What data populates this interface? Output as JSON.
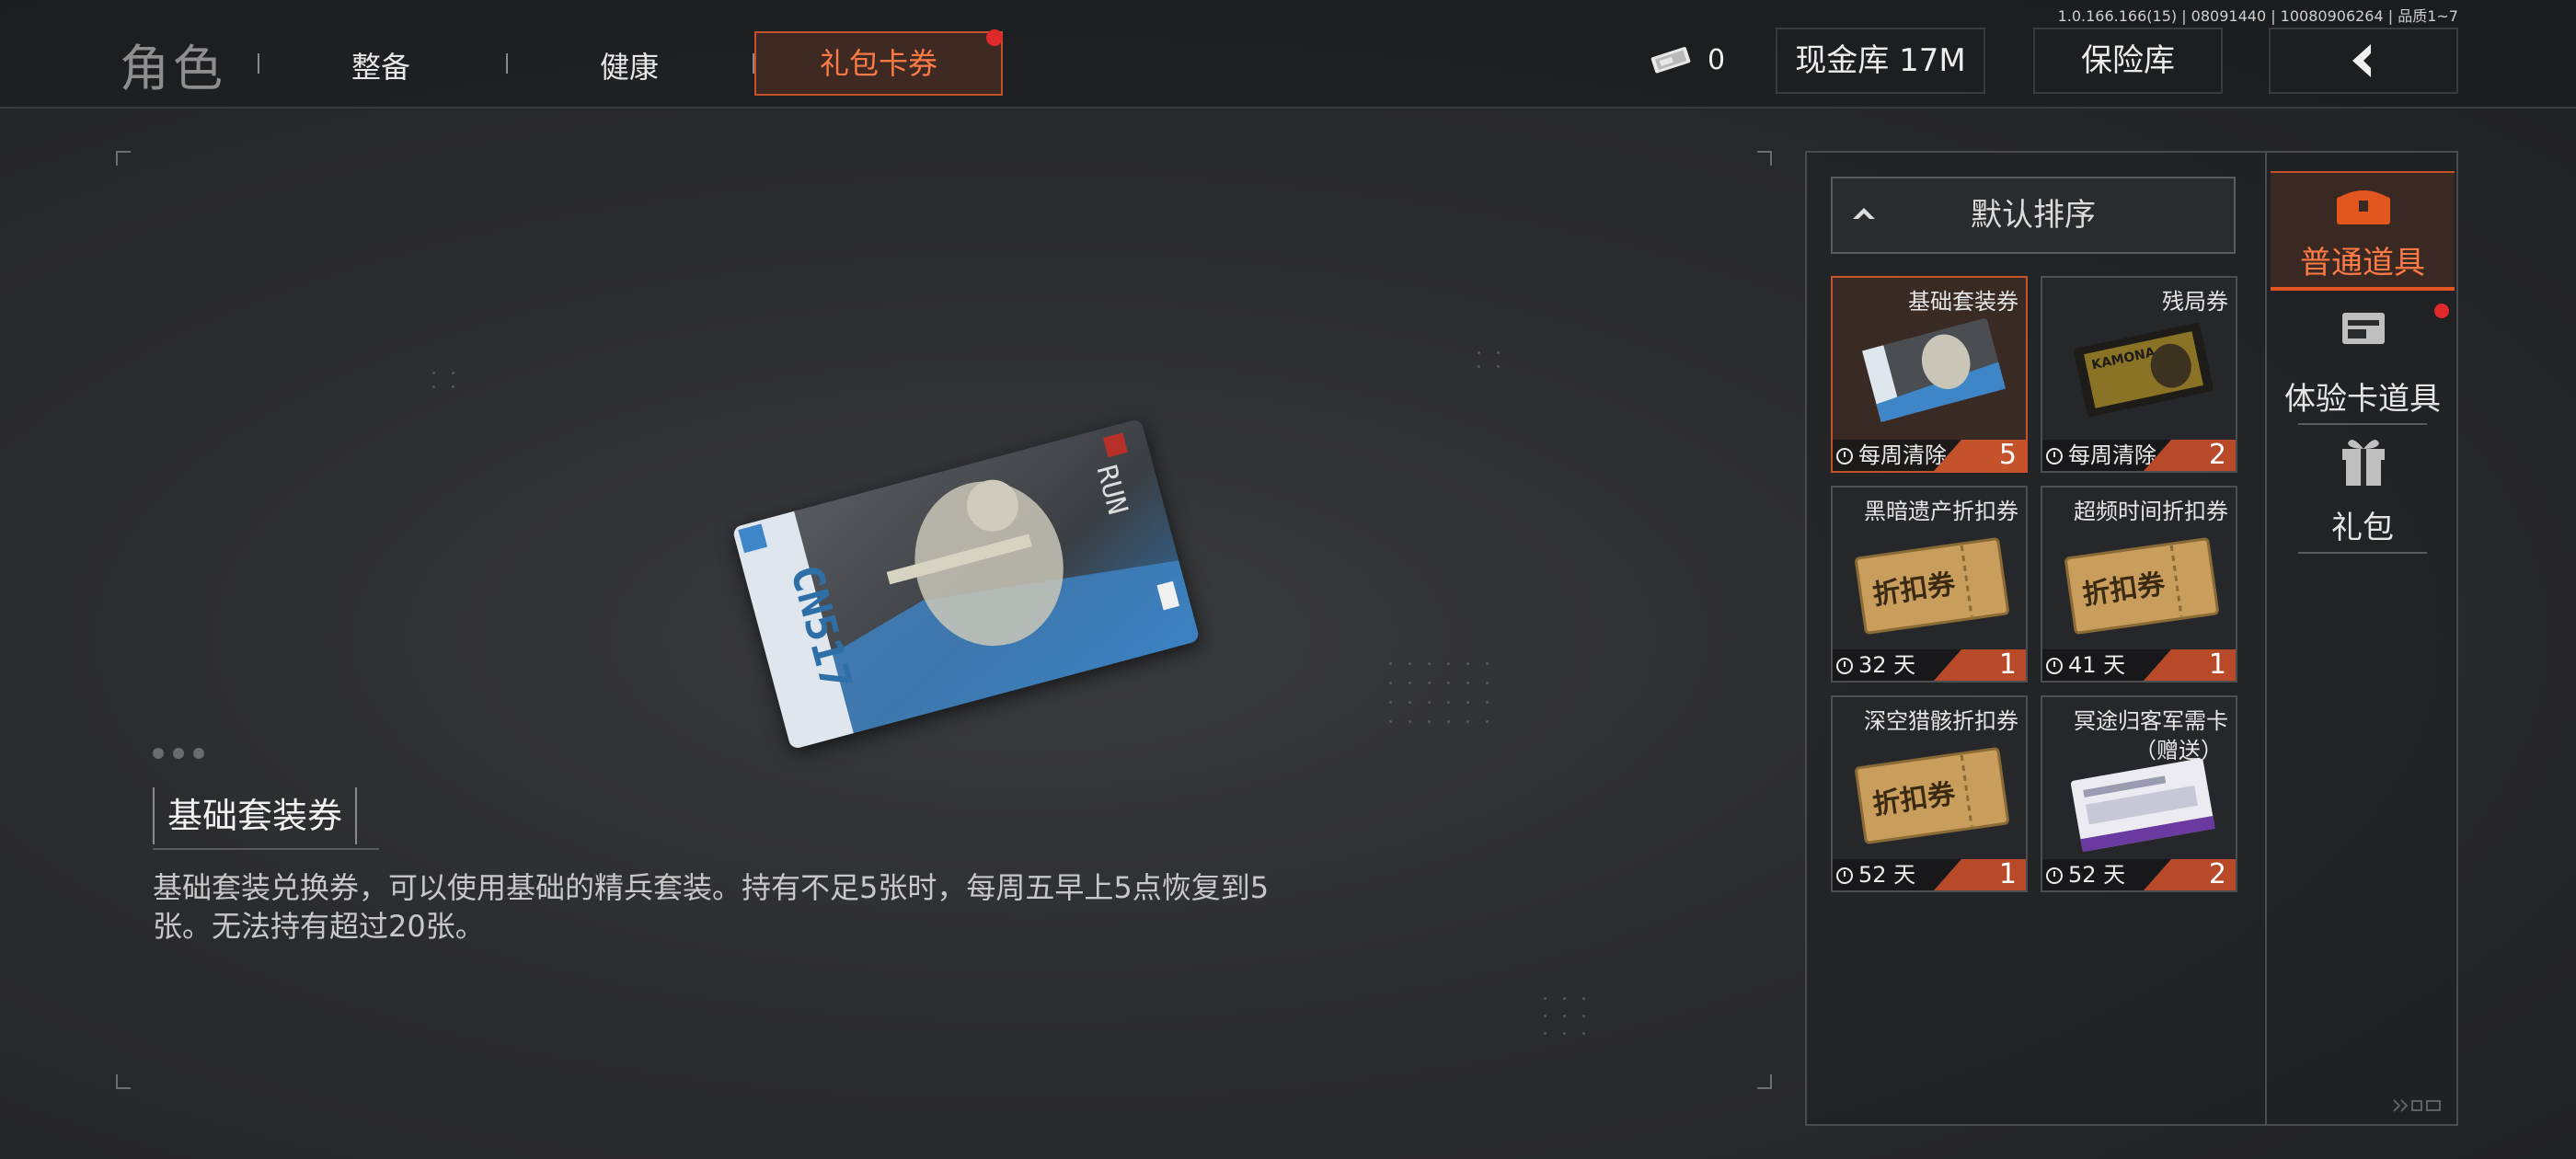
{
  "version": "1.0.166.166(15) | 08091440 | 10080906264 | 品质1~7",
  "header": {
    "title": "角色",
    "tabs": [
      "整备",
      "健康"
    ],
    "active_tab": "礼包卡券",
    "ticket_count": "0",
    "cash_label": "现金库 17M",
    "vault_label": "保险库",
    "back_icon": "back-chevron-icon"
  },
  "detail": {
    "title": "基础套装券",
    "description": "基础套装兑换券，可以使用基础的精兵套装。持有不足5张时，每周五早上5点恢复到5张。无法持有超过20张。"
  },
  "sort": {
    "label": "默认排序"
  },
  "items": [
    {
      "name": "基础套装券",
      "time": "每周清除",
      "count": "5"
    },
    {
      "name": "残局券",
      "time": "每周清除",
      "count": "2"
    },
    {
      "name": "黑暗遗产折扣券",
      "time": "32 天",
      "count": "1"
    },
    {
      "name": "超频时间折扣券",
      "time": "41 天",
      "count": "1"
    },
    {
      "name": "深空猎骸折扣券",
      "time": "52 天",
      "count": "1"
    },
    {
      "name": "冥途归客军需卡",
      "name_sub": "（赠送）",
      "time": "52 天",
      "count": "2"
    }
  ],
  "ticket_art_text": "折扣券",
  "card_art_text": "KAMONA",
  "categories": [
    {
      "label": "普通道具",
      "icon": "chest-icon"
    },
    {
      "label": "体验卡道具",
      "icon": "card-icon"
    },
    {
      "label": "礼包",
      "icon": "gift-icon"
    }
  ],
  "colors": {
    "accent": "#e2561f",
    "notify": "#e0292a"
  }
}
